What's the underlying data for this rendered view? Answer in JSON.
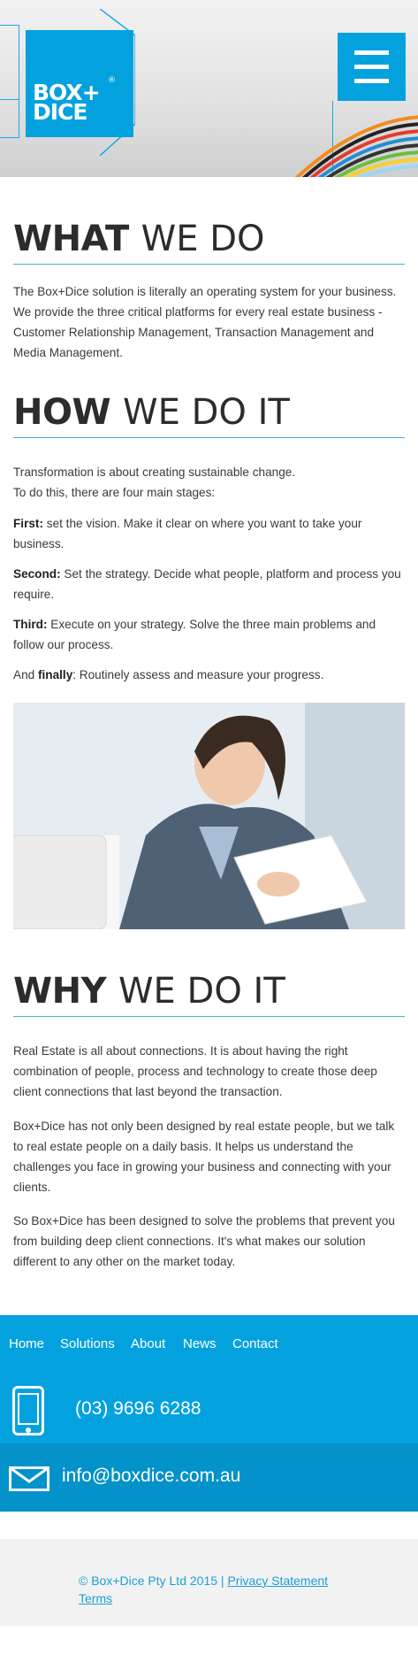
{
  "brand": {
    "logo_line1": "BOX+",
    "logo_line2": "DICE",
    "logo_reg": "®",
    "accent": "#03a2df"
  },
  "header": {
    "menu_icon": "hamburger-menu-icon"
  },
  "what": {
    "title_bold": "WHAT",
    "title_light": "WE DO",
    "body": "The Box+Dice solution is literally an operating system for your business. We provide the three critical platforms for every real estate business - Customer Relationship Management, Transaction Management and Media Management."
  },
  "how": {
    "title_bold": "HOW",
    "title_light": "WE DO IT",
    "intro_line1": "Transformation is about creating sustainable change.",
    "intro_line2": "To do this, there are four main stages:",
    "steps": [
      {
        "label": "First:",
        "text": "set the vision. Make it clear on where you want to take your business."
      },
      {
        "label": "Second:",
        "text": "Set the strategy. Decide what people, platform and process you require."
      },
      {
        "label": "Third:",
        "text": "Execute on your strategy. Solve the three main problems and follow our process."
      }
    ],
    "final_prefix": "And",
    "final_label": "finally",
    "final_text": ": Routinely assess and measure your progress."
  },
  "why": {
    "title_bold": "WHY",
    "title_light": "WE DO IT",
    "paragraphs": [
      "Real Estate is all about connections. It is about having the right combination of people, process and technology to create those deep client connections that last beyond the transaction.",
      "Box+Dice has not only been designed by real estate people, but we talk to real estate people on a daily basis. It helps us understand the challenges you face in growing your business and connecting with your clients.",
      "So Box+Dice has been designed to solve the problems that prevent you from building deep client connections. It's what makes our solution different to any other on the market today."
    ]
  },
  "footer": {
    "nav": [
      "Home",
      "Solutions",
      "About",
      "News",
      "Contact"
    ],
    "phone": "(03) 9696 6288",
    "phone_icon": "mobile-phone-icon",
    "email": "info@boxdice.com.au",
    "email_icon": "envelope-icon",
    "copyright": "© Box+Dice Pty Ltd 2015 |",
    "privacy": "Privacy Statement",
    "terms": "Terms"
  }
}
